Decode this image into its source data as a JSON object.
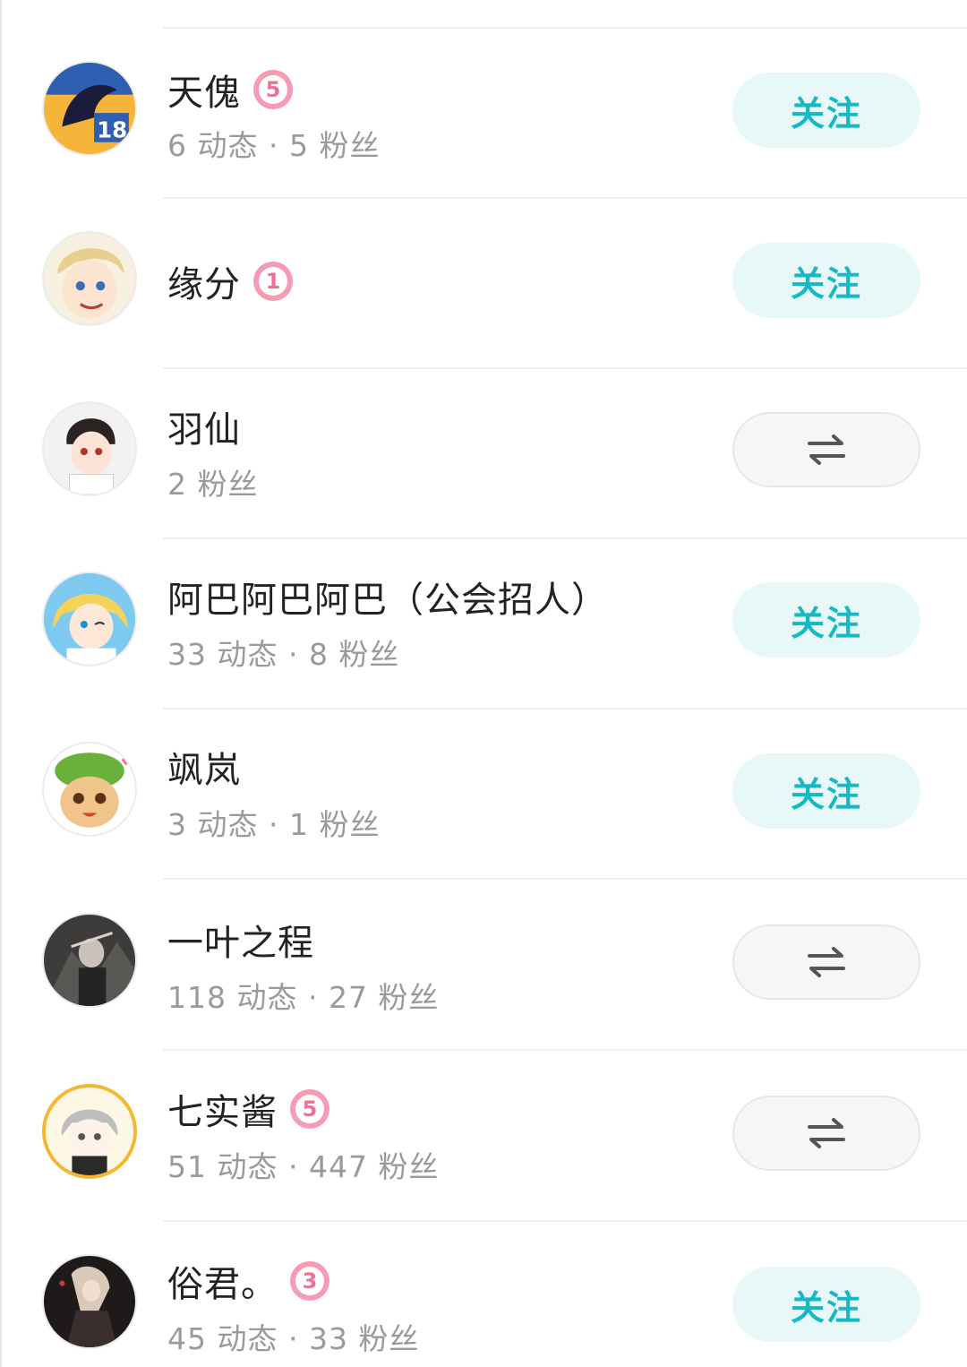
{
  "users": [
    {
      "name": "天傀",
      "stats": "6 动态 · 5 粉丝",
      "badge": "5",
      "button": {
        "type": "follow",
        "label": "关注"
      }
    },
    {
      "name": "缘分",
      "stats": "",
      "badge": "1",
      "button": {
        "type": "follow",
        "label": "关注"
      }
    },
    {
      "name": "羽仙",
      "stats": "2 粉丝",
      "badge": null,
      "button": {
        "type": "mutual",
        "icon": "swap-arrows-icon"
      }
    },
    {
      "name": "阿巴阿巴阿巴（公会招人）",
      "stats": "33 动态 · 8 粉丝",
      "badge": null,
      "button": {
        "type": "follow",
        "label": "关注"
      }
    },
    {
      "name": "飒岚",
      "stats": "3 动态 · 1 粉丝",
      "badge": null,
      "button": {
        "type": "follow",
        "label": "关注"
      }
    },
    {
      "name": "一叶之程",
      "stats": "118 动态 · 27 粉丝",
      "badge": null,
      "button": {
        "type": "mutual",
        "icon": "swap-arrows-icon"
      }
    },
    {
      "name": "七实酱",
      "stats": "51 动态 · 447 粉丝",
      "badge": "5",
      "button": {
        "type": "mutual",
        "icon": "swap-arrows-icon"
      }
    },
    {
      "name": "俗君。",
      "stats": "45 动态 · 33 粉丝",
      "badge": "3",
      "button": {
        "type": "follow",
        "label": "关注"
      }
    }
  ],
  "colors": {
    "accent": "#15b9c4",
    "follow_bg": "#e8f8f9",
    "badge_pink": "#f59bb3"
  }
}
